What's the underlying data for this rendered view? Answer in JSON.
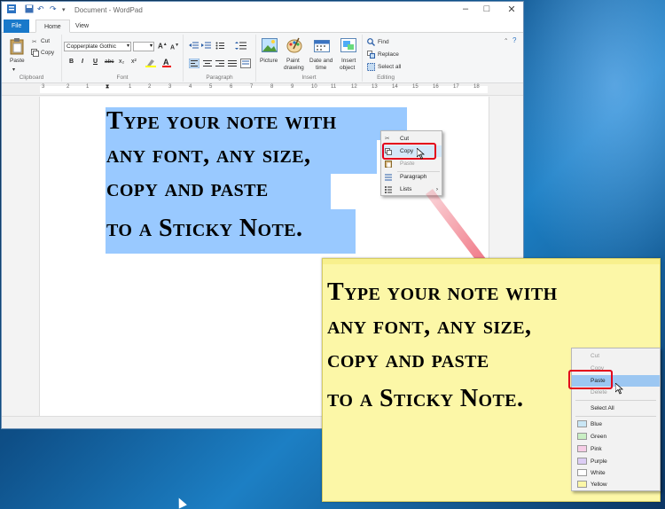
{
  "window": {
    "title": "Document - WordPad",
    "controls": {
      "minimize": "–",
      "maximize": "□",
      "close": "✕"
    }
  },
  "tabs": [
    "File",
    "Home",
    "View"
  ],
  "ribbon": {
    "clipboard": {
      "label": "Clipboard",
      "paste": "Paste",
      "cut": "Cut",
      "copy": "Copy"
    },
    "font": {
      "label": "Font",
      "family": "Copperplate Gothic",
      "size": "",
      "bold": "B",
      "italic": "I",
      "underline": "U",
      "strike": "abc",
      "sub": "x₂",
      "sup": "x²"
    },
    "paragraph": {
      "label": "Paragraph"
    },
    "insert": {
      "label": "Insert",
      "picture": "Picture",
      "paint1": "Paint",
      "paint2": "drawing",
      "date1": "Date and",
      "date2": "time",
      "obj1": "Insert",
      "obj2": "object"
    },
    "editing": {
      "label": "Editing",
      "find": "Find",
      "replace": "Replace",
      "select_all": "Select all"
    }
  },
  "ruler": [
    "3",
    "2",
    "1",
    "1",
    "2",
    "3",
    "4",
    "5",
    "6",
    "7",
    "8",
    "9",
    "10",
    "11",
    "12",
    "13",
    "14",
    "15",
    "16",
    "17",
    "18"
  ],
  "note_text": {
    "line1": "Type your note with",
    "line2": "any font, any size,",
    "line3": "copy and paste",
    "line4": "to a Sticky Note."
  },
  "wordpad_menu": {
    "cut": "Cut",
    "copy": "Copy",
    "paste": "Paste",
    "paragraph": "Paragraph",
    "lists": "Lists",
    "submenu_arrow": "›"
  },
  "sticky_menu": {
    "cut": "Cut",
    "copy": "Copy",
    "paste": "Paste",
    "delete": "Delete",
    "select_all": "Select All",
    "colors": [
      {
        "name": "Blue",
        "color": "#c9e6f5"
      },
      {
        "name": "Green",
        "color": "#c9efc4"
      },
      {
        "name": "Pink",
        "color": "#f6cde6"
      },
      {
        "name": "Purple",
        "color": "#dccdf5"
      },
      {
        "name": "White",
        "color": "#ffffff"
      },
      {
        "name": "Yellow",
        "color": "#fcf7a7"
      }
    ]
  },
  "colors": {
    "accent": "#1979ca",
    "selection": "#99c9ff",
    "highlight": "#e3001b",
    "sticky": "#fcf7a7"
  }
}
